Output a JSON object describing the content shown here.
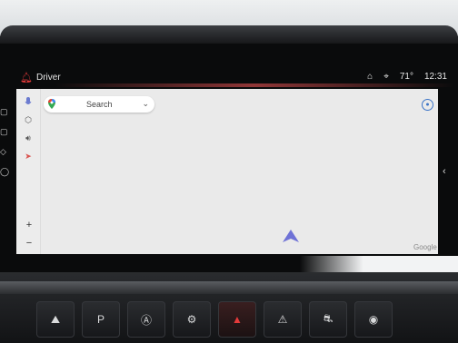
{
  "status_bar": {
    "profile_icon": "bell-user-icon",
    "profile_name": "Driver",
    "icons": [
      "car-icon",
      "location-pin-icon"
    ],
    "temperature": "71°",
    "time": "12:31",
    "accent_color": "#e53a3a"
  },
  "map": {
    "search_label": "Search",
    "logo_text": "Google",
    "zoom_in": "+",
    "zoom_out": "−"
  },
  "left_rail": [
    "microphone-icon",
    "settings-hex-icon",
    "volume-icon",
    "navigation-icon"
  ],
  "hardware_buttons": [
    "hill-descent-icon",
    "park-assist-icon",
    "auto-stop-icon",
    "drive-mode-icon",
    "hazard-icon",
    "traction-icon",
    "off-road-icon",
    "camera-icon"
  ]
}
